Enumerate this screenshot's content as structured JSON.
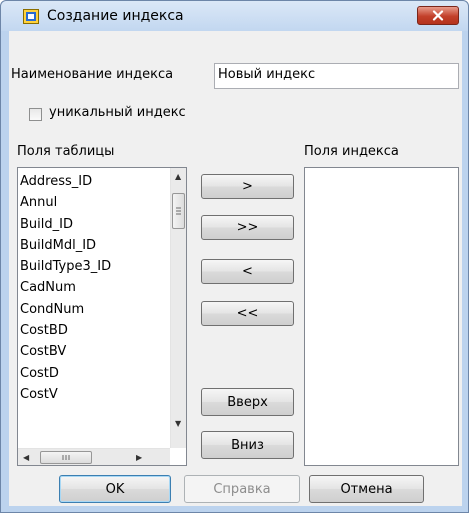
{
  "window": {
    "title": "Создание индекса",
    "icon": "app-icon",
    "close_icon": "close-icon"
  },
  "index_name": {
    "label": "Наименование индекса",
    "value": "Новый индекс"
  },
  "unique": {
    "label": "уникальный индекс",
    "checked": false
  },
  "table_fields": {
    "header": "Поля таблицы",
    "items": [
      "Address_ID",
      "Annul",
      "Build_ID",
      "BuildMdl_ID",
      "BuildType3_ID",
      "CadNum",
      "CondNum",
      "CostBD",
      "CostBV",
      "CostD",
      "CostV"
    ]
  },
  "index_fields": {
    "header": "Поля индекса",
    "items": []
  },
  "move_buttons": {
    "add": ">",
    "add_all": ">>",
    "remove": "<",
    "remove_all": "<<",
    "up": "Вверх",
    "down": "Вниз"
  },
  "footer": {
    "ok": "OK",
    "help": "Справка",
    "cancel": "Отмена"
  },
  "colors": {
    "frame": "#bcd3ee",
    "close_button": "#c2402a",
    "dialog_bg": "#f0f0f0"
  }
}
